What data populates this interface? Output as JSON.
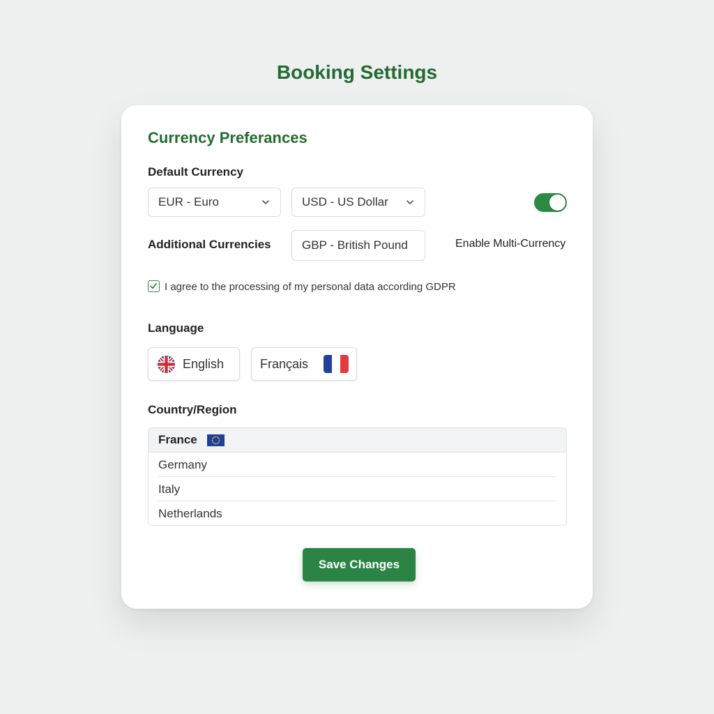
{
  "page": {
    "title": "Booking Settings"
  },
  "currency": {
    "section_title": "Currency Preferances",
    "default_label": "Default Currency",
    "primary_select": {
      "value": "EUR - Euro",
      "icon": "chevron-down-icon"
    },
    "secondary_select": {
      "value": "USD - US Dollar",
      "icon": "chevron-down-icon"
    },
    "additional_label": "Additional Currencies",
    "additional_value": "GBP - British Pound",
    "multi_currency": {
      "label": "Enable Multi-Currency",
      "enabled": true,
      "color": "#2d8a45"
    }
  },
  "consent": {
    "checked": true,
    "label": "I agree to the processing of my personal data according GDPR"
  },
  "language": {
    "label": "Language",
    "options": [
      {
        "label": "English",
        "flag": "uk-flag-icon"
      },
      {
        "label": "Français",
        "flag": "france-flag-icon"
      }
    ]
  },
  "region": {
    "label": "Country/Region",
    "countries": [
      {
        "name": "France",
        "selected": true,
        "flag": "eu-flag-icon"
      },
      {
        "name": "Germany",
        "selected": false
      },
      {
        "name": "Italy",
        "selected": false
      },
      {
        "name": "Netherlands",
        "selected": false
      }
    ]
  },
  "actions": {
    "save_label": "Save Changes"
  },
  "colors": {
    "accent": "#236b32",
    "button": "#2b8445",
    "background": "#eeefef"
  }
}
